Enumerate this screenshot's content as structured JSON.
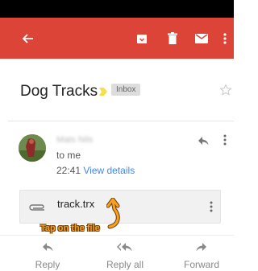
{
  "toolbar": {
    "icons": [
      "back-arrow-icon",
      "archive-icon",
      "delete-icon",
      "mail-icon",
      "more-vert-icon"
    ]
  },
  "subject": {
    "title": "Dog Tracks",
    "label": "Inbox"
  },
  "message": {
    "sender": "Mats Nils",
    "to": "to me",
    "time": "22:41",
    "view_details": "View details"
  },
  "attachment": {
    "name": "track.trx"
  },
  "callout": "Tap on the file",
  "actions": {
    "reply": "Reply",
    "reply_all": "Reply all",
    "forward": "Forward"
  },
  "colors": {
    "toolbar": "#db4437",
    "link": "#4285f4",
    "callout": "#f7a021",
    "importance": "#f4e04d"
  }
}
